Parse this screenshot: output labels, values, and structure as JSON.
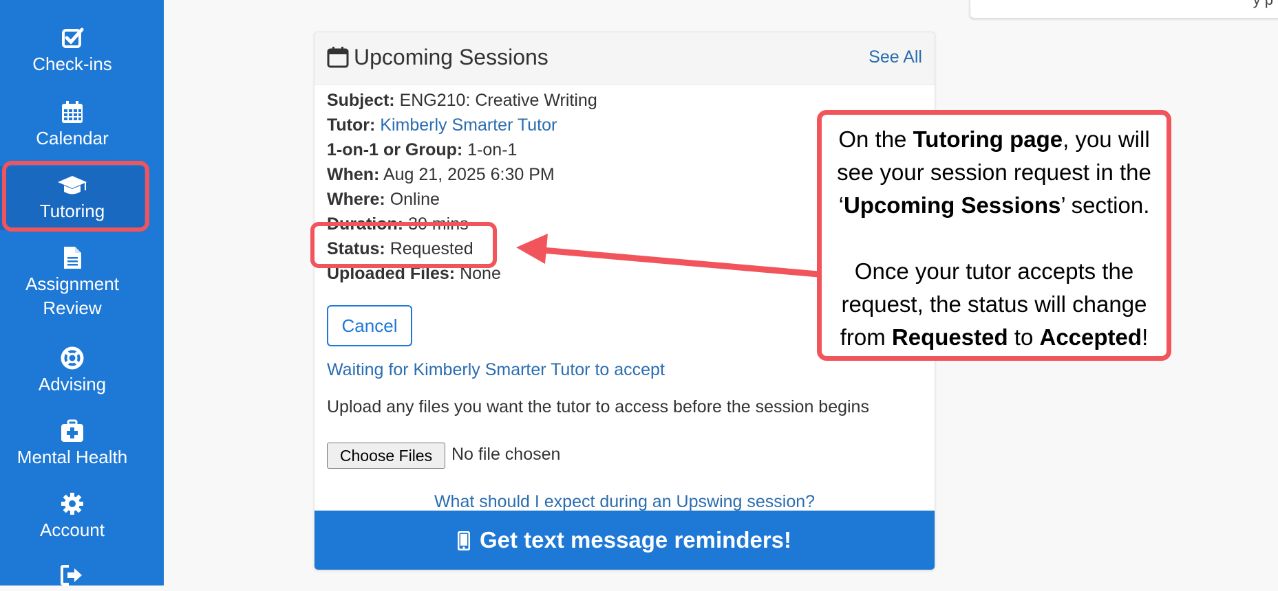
{
  "sidebar": {
    "items": [
      {
        "label": "Check-ins",
        "icon": "checkbox-icon"
      },
      {
        "label": "Calendar",
        "icon": "calendar-icon"
      },
      {
        "label": "Tutoring",
        "icon": "graduation-cap-icon",
        "active": true
      },
      {
        "label": "Assignment Review",
        "label_line1": "Assignment",
        "label_line2": "Review",
        "icon": "document-icon"
      },
      {
        "label": "Advising",
        "icon": "lifebuoy-icon"
      },
      {
        "label": "Mental Health",
        "icon": "medical-kit-icon"
      },
      {
        "label": "Account",
        "icon": "gear-icon"
      },
      {
        "label": "",
        "icon": "sign-out-icon"
      }
    ]
  },
  "card": {
    "title": "Upcoming Sessions",
    "see_all": "See All",
    "subject_label": "Subject:",
    "subject_value": "ENG210: Creative Writing",
    "tutor_label": "Tutor:",
    "tutor_value": "Kimberly Smarter Tutor",
    "format_label": "1-on-1 or Group:",
    "format_value": "1-on-1",
    "when_label": "When:",
    "when_value": "Aug 21, 2025 6:30 PM",
    "where_label": "Where:",
    "where_value": "Online",
    "duration_label": "Duration:",
    "duration_value": "30 mins",
    "status_label": "Status:",
    "status_value": "Requested",
    "files_label": "Uploaded Files:",
    "files_value": "None",
    "cancel_label": "Cancel",
    "waiting_text": "Waiting for Kimberly Smarter Tutor to accept",
    "upload_note": "Upload any files you want the tutor to access before the session begins",
    "choose_files_label": "Choose Files",
    "no_file_text": "No file chosen",
    "expect_link": "What should I expect during an Upswing session?",
    "sms_label": "Get text message reminders!"
  },
  "top_fragment_text": "y    p",
  "callout": {
    "p1_a": "On the ",
    "p1_b": "Tutoring page",
    "p1_c": ", you will see your session request in the ‘",
    "p1_d": "Upcoming Sessions",
    "p1_e": "’ section.",
    "p2_a": "Once your tutor accepts the request, the status will change from ",
    "p2_b": "Requested",
    "p2_c": " to ",
    "p2_d": "Accepted",
    "p2_e": "!"
  },
  "colors": {
    "sidebar": "#1d78d6",
    "link": "#2a6db0",
    "highlight": "#f1545b"
  }
}
